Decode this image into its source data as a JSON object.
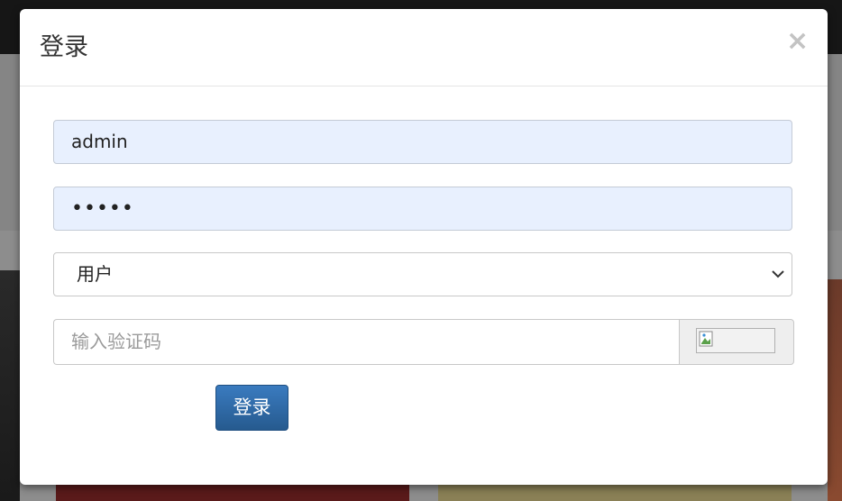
{
  "modal": {
    "title": "登录",
    "close_glyph": "×"
  },
  "form": {
    "username_value": "admin",
    "password_value": "•••••",
    "role_selected": "用户",
    "captcha_placeholder": "输入验证码",
    "submit_label": "登录"
  },
  "icons": {
    "close": "close-icon",
    "select_arrow": "chevron-down-icon",
    "captcha": "broken-image-icon"
  },
  "colors": {
    "primary_button": "#2f6da6",
    "autofill_background": "#e8f0fe",
    "close_icon": "#c3c3c3"
  }
}
